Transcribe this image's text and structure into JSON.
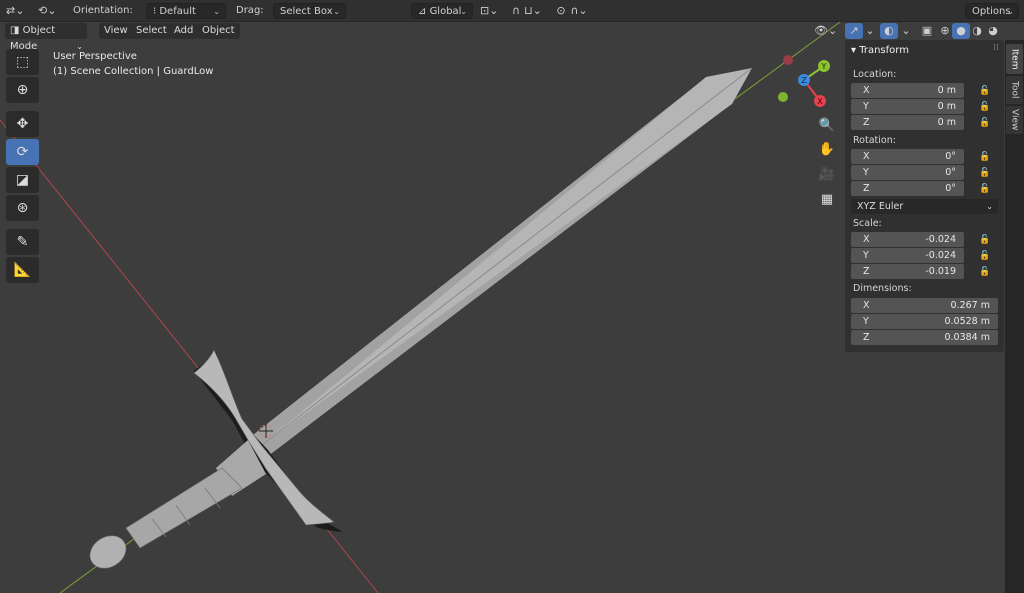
{
  "header": {
    "orientation_label": "Orientation:",
    "orientation_value": "Default",
    "drag_label": "Drag:",
    "drag_value": "Select Box",
    "transform_space": "Global",
    "options_label": "Options"
  },
  "viewport_menu": {
    "mode": "Object Mode",
    "view": "View",
    "select": "Select",
    "add": "Add",
    "object": "Object"
  },
  "overlay": {
    "perspective": "User Perspective",
    "collection": "(1) Scene Collection | GuardLow"
  },
  "gizmo": {
    "x": "X",
    "y": "Y",
    "z": "Z"
  },
  "tabs": [
    "Item",
    "Tool",
    "View"
  ],
  "transform": {
    "title": "Transform",
    "location_label": "Location:",
    "location": [
      {
        "axis": "X",
        "value": "0 m"
      },
      {
        "axis": "Y",
        "value": "0 m"
      },
      {
        "axis": "Z",
        "value": "0 m"
      }
    ],
    "rotation_label": "Rotation:",
    "rotation": [
      {
        "axis": "X",
        "value": "0°"
      },
      {
        "axis": "Y",
        "value": "0°"
      },
      {
        "axis": "Z",
        "value": "0°"
      }
    ],
    "rotation_mode": "XYZ Euler",
    "scale_label": "Scale:",
    "scale": [
      {
        "axis": "X",
        "value": "-0.024"
      },
      {
        "axis": "Y",
        "value": "-0.024"
      },
      {
        "axis": "Z",
        "value": "-0.019"
      }
    ],
    "dimensions_label": "Dimensions:",
    "dimensions": [
      {
        "axis": "X",
        "value": "0.267 m"
      },
      {
        "axis": "Y",
        "value": "0.0528 m"
      },
      {
        "axis": "Z",
        "value": "0.0384 m"
      }
    ]
  },
  "colors": {
    "accent": "#4772b3",
    "x_axis": "#e8414d",
    "y_axis": "#8ac431",
    "z_axis": "#3b8be0"
  }
}
